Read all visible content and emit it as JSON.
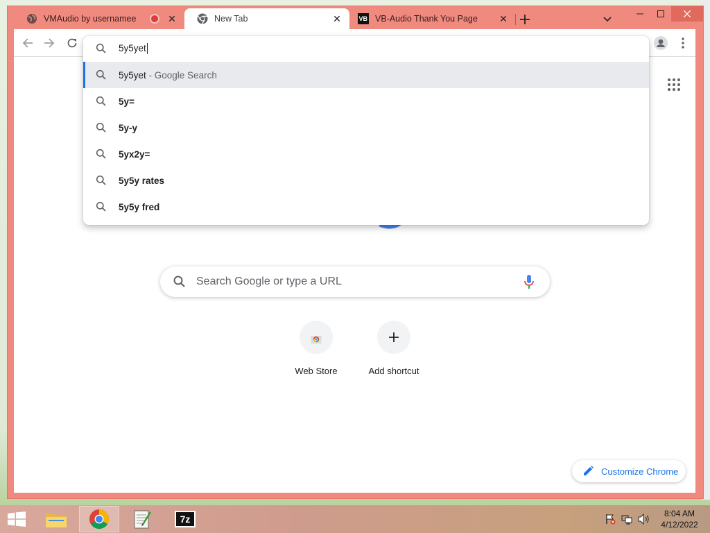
{
  "tabs": [
    {
      "title": "VMAudio by usernamee",
      "favicon": "globe-icon",
      "recording": true
    },
    {
      "title": "New Tab",
      "favicon": "chrome-icon",
      "active": true
    },
    {
      "title": "VB-Audio Thank You Page",
      "favicon": "vb-logo-icon"
    }
  ],
  "omnibox": {
    "typed": "5y5yet",
    "suggestions": [
      {
        "main": "5y5yet",
        "sub": " - Google Search",
        "selected": true
      },
      {
        "main": "5y="
      },
      {
        "main": "5y-y"
      },
      {
        "main": "5yx2y="
      },
      {
        "main": "5y5y rates"
      },
      {
        "main": "5y5y fred"
      }
    ]
  },
  "ntp": {
    "search_placeholder": "Search Google or type a URL",
    "shortcuts": [
      {
        "label": "Web Store",
        "icon": "webstore-icon"
      },
      {
        "label": "Add shortcut",
        "icon": "plus-icon"
      }
    ],
    "customize_label": "Customize Chrome"
  },
  "taskbar": {
    "apps": [
      "file-explorer-icon",
      "chrome-icon",
      "notepad-icon",
      "7zip-icon"
    ],
    "seven_zip_text": "7z",
    "clock_time": "8:04 AM",
    "clock_date": "4/12/2022"
  },
  "colors": {
    "frame": "#f08a7f",
    "accent": "#1a73e8",
    "selected_row": "#e8eaed"
  }
}
